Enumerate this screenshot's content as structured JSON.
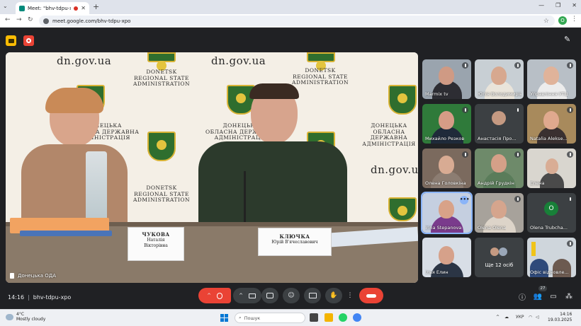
{
  "browser": {
    "tab_title": "Meet: \"bhv-tdpu-xpo\"",
    "new_tab": "+",
    "url": "meet.google.com/bhv-tdpu-xpo",
    "profile_initial": "O"
  },
  "main_video": {
    "wall_site": "dn.gov.ua",
    "wall_en_1": "DONETSK",
    "wall_en_2": "REGIONAL STATE",
    "wall_en_3": "ADMINISTRATION",
    "wall_ua_1": "ДОНЕЦЬКА",
    "wall_ua_2": "ОБЛАСНА ДЕРЖАВНА",
    "wall_ua_3": "АДМІНІСТРАЦІЯ",
    "plate_left_surname": "ЧУКОВА",
    "plate_left_name1": "Наталія",
    "plate_left_name2": "Вікторівна",
    "plate_right_surname": "КЛЮЧКА",
    "plate_right_name": "Юрій В'ячеславович",
    "participant_label": "Донецька ОДА"
  },
  "participants": [
    {
      "name": "Marmix tv"
    },
    {
      "name": "Юлія Володимирівна"
    },
    {
      "name": "Управління УТЦ"
    },
    {
      "name": "Михайло Резков"
    },
    {
      "name": "Анастасія Про..."
    },
    {
      "name": "Natalia Alekse..."
    },
    {
      "name": "Олена Головкіна"
    },
    {
      "name": "Андрій Грудкін"
    },
    {
      "name": "Елена"
    },
    {
      "name": "Irina Stepanova",
      "more": "•••"
    },
    {
      "name": "Olena Olena"
    },
    {
      "name": "Olena Trubcha...",
      "initial": "O"
    },
    {
      "name": "Ілья Елин"
    },
    {
      "name": "Ще 12 осіб"
    },
    {
      "name": "Офіс відновле..."
    }
  ],
  "bottom": {
    "time": "14:16",
    "meeting_code": "bhv-tdpu-xpo",
    "people_count": "27"
  },
  "taskbar": {
    "temperature": "4°C",
    "weather": "Mostly cloudy",
    "search_placeholder": "Пошук",
    "lang": "УКР",
    "clock_time": "14:16",
    "clock_date": "19.03.2025"
  },
  "colors": {
    "meet_bg": "#202124",
    "end_call": "#ea4335",
    "active_outline": "#8ab4f8"
  }
}
